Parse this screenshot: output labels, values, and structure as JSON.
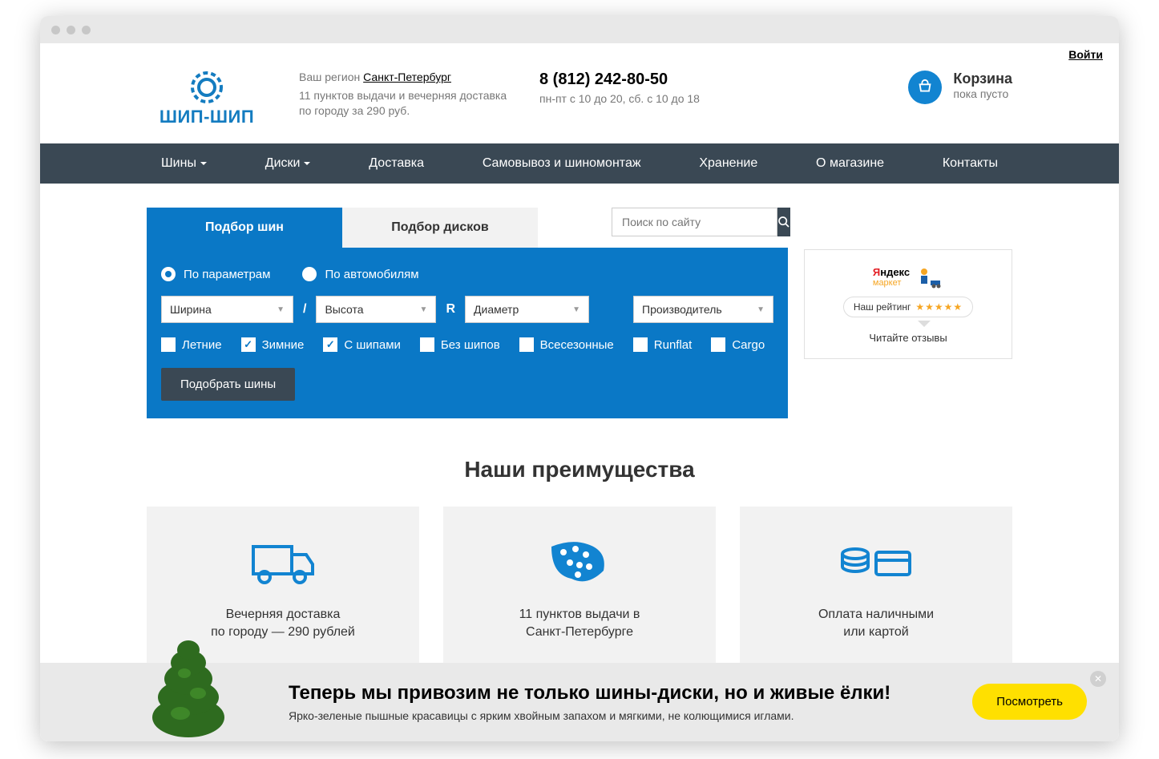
{
  "top": {
    "login_label": "Войти"
  },
  "header": {
    "brand": "ШИП-ШИП",
    "region_label": "Ваш регион",
    "region_city": "Санкт-Петербург",
    "region_sub": "11 пунктов выдачи и вечерняя доставка по городу за 290 руб.",
    "phone": "8 (812) 242-80-50",
    "phone_sub": "пн-пт с 10 до 20, сб. с 10 до 18",
    "cart_title": "Корзина",
    "cart_sub": "пока пусто"
  },
  "nav": {
    "items": [
      {
        "label": "Шины",
        "dropdown": true
      },
      {
        "label": "Диски",
        "dropdown": true
      },
      {
        "label": "Доставка",
        "dropdown": false
      },
      {
        "label": "Самовывоз и шиномонтаж",
        "dropdown": false
      },
      {
        "label": "Хранение",
        "dropdown": false
      },
      {
        "label": "О магазине",
        "dropdown": false
      },
      {
        "label": "Контакты",
        "dropdown": false
      }
    ]
  },
  "tabs": {
    "tires": "Подбор шин",
    "disks": "Подбор дисков"
  },
  "search": {
    "placeholder": "Поиск по сайту"
  },
  "filter": {
    "radio1": "По параметрам",
    "radio2": "По автомобилям",
    "width": "Ширина",
    "height": "Высота",
    "diameter": "Диаметр",
    "manufacturer": "Производитель",
    "slash": "/",
    "r": "R",
    "chk_summer": "Летние",
    "chk_winter": "Зимние",
    "chk_studs": "С шипами",
    "chk_nostuds": "Без шипов",
    "chk_allseason": "Всесезонные",
    "chk_runflat": "Runflat",
    "chk_cargo": "Cargo",
    "submit": "Подобрать шины"
  },
  "widget": {
    "yandex_y": "Я",
    "yandex_rest": "ндекс",
    "yandex_market": "маркет",
    "rating_label": "Наш рейтинг",
    "stars": "★★★★★",
    "reviews": "Читайте отзывы"
  },
  "advantages": {
    "title": "Наши преимущества",
    "card1_l1": "Вечерняя доставка",
    "card1_l2": "по городу — 290 рублей",
    "card2_l1": "11 пунктов выдачи в",
    "card2_l2": "Санкт-Петербурге",
    "card3_l1": "Оплата наличными",
    "card3_l2": "или картой"
  },
  "banner": {
    "title": "Теперь мы привозим не только шины-диски, но и живые ёлки!",
    "sub": "Ярко-зеленые пышные красавицы с ярким хвойным запахом и мягкими, не колющимися иглами.",
    "button": "Посмотреть"
  }
}
